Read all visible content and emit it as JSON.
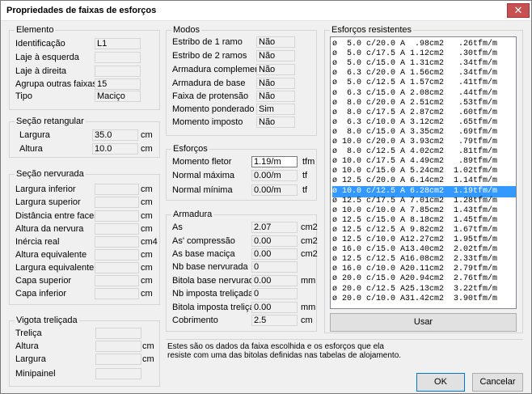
{
  "window": {
    "title": "Propriedades de faixas de esforços",
    "close": "✕"
  },
  "elemento": {
    "legend": "Elemento",
    "rows": [
      {
        "label": "Identificação",
        "value": "L1"
      },
      {
        "label": "Laje à esquerda",
        "value": ""
      },
      {
        "label": "Laje à direita",
        "value": ""
      },
      {
        "label": "Agrupa outras faixas",
        "value": "15"
      },
      {
        "label": "Tipo",
        "value": "Maciço"
      }
    ]
  },
  "secao_ret": {
    "legend": "Seção retangular",
    "rows": [
      {
        "label": "Largura",
        "value": "35.0",
        "unit": "cm"
      },
      {
        "label": "Altura",
        "value": "10.0",
        "unit": "cm"
      }
    ]
  },
  "secao_nerv": {
    "legend": "Seção nervurada",
    "rows": [
      {
        "label": "Largura inferior",
        "value": "",
        "unit": "cm"
      },
      {
        "label": "Largura superior",
        "value": "",
        "unit": "cm"
      },
      {
        "label": "Distância entre faces",
        "value": "",
        "unit": "cm"
      },
      {
        "label": "Altura da nervura",
        "value": "",
        "unit": "cm"
      },
      {
        "label": "Inércia real",
        "value": "",
        "unit": "cm4"
      },
      {
        "label": "Altura equivalente",
        "value": "",
        "unit": "cm"
      },
      {
        "label": "Largura equivalente",
        "value": "",
        "unit": "cm"
      },
      {
        "label": "Capa superior",
        "value": "",
        "unit": "cm"
      },
      {
        "label": "Capa inferior",
        "value": "",
        "unit": "cm"
      }
    ]
  },
  "vigota": {
    "legend": "Vigota treliçada",
    "rows": [
      {
        "label": "Treliça",
        "value": "",
        "unit": ""
      },
      {
        "label": "Altura",
        "value": "",
        "unit": "cm"
      },
      {
        "label": "Largura",
        "value": "",
        "unit": "cm"
      },
      {
        "label": "Minipainel",
        "value": "",
        "unit": ""
      }
    ]
  },
  "modos": {
    "legend": "Modos",
    "rows": [
      {
        "label": "Estribo de 1 ramo",
        "value": "Não"
      },
      {
        "label": "Estribo de 2 ramos",
        "value": "Não"
      },
      {
        "label": "Armadura complementar",
        "value": "Não"
      },
      {
        "label": "Armadura de base",
        "value": "Não"
      },
      {
        "label": "Faixa de protensão",
        "value": "Não"
      },
      {
        "label": "Momento ponderado",
        "value": "Sim"
      },
      {
        "label": "Momento imposto",
        "value": "Não"
      }
    ]
  },
  "esforcos": {
    "legend": "Esforços",
    "rows": [
      {
        "label": "Momento fletor",
        "value": "1.19/m",
        "unit": "tfm"
      },
      {
        "label": "Normal máxima",
        "value": "0.00/m",
        "unit": "tf"
      },
      {
        "label": "Normal mínima",
        "value": "0.00/m",
        "unit": "tf"
      }
    ]
  },
  "armadura": {
    "legend": "Armadura",
    "rows": [
      {
        "label": "As",
        "value": "2.07",
        "unit": "cm2"
      },
      {
        "label": "As' compressão",
        "value": "0.00",
        "unit": "cm2"
      },
      {
        "label": "As base maciça",
        "value": "0.00",
        "unit": "cm2"
      },
      {
        "label": "Nb base nervurada",
        "value": "0",
        "unit": ""
      },
      {
        "label": "Bitola base nervurada",
        "value": "0.00",
        "unit": "mm"
      },
      {
        "label": "Nb imposta treliçada",
        "value": "0",
        "unit": ""
      },
      {
        "label": "Bitola imposta treliçada",
        "value": "0.00",
        "unit": "mm"
      },
      {
        "label": "Cobrimento",
        "value": "2.5",
        "unit": "cm"
      }
    ]
  },
  "resistentes": {
    "legend": "Esforços resistentes",
    "selected_index": 12,
    "items": [
      "ø  5.0 c/20.0 A  .98cm2   .26tfm/m",
      "ø  5.0 c/17.5 A 1.12cm2   .30tfm/m",
      "ø  5.0 c/15.0 A 1.31cm2   .34tfm/m",
      "ø  6.3 c/20.0 A 1.56cm2   .34tfm/m",
      "ø  5.0 c/12.5 A 1.57cm2   .41tfm/m",
      "ø  6.3 c/15.0 A 2.08cm2   .44tfm/m",
      "ø  8.0 c/20.0 A 2.51cm2   .53tfm/m",
      "ø  8.0 c/17.5 A 2.87cm2   .60tfm/m",
      "ø  6.3 c/10.0 A 3.12cm2   .65tfm/m",
      "ø  8.0 c/15.0 A 3.35cm2   .69tfm/m",
      "ø 10.0 c/20.0 A 3.93cm2   .79tfm/m",
      "ø  8.0 c/12.5 A 4.02cm2   .81tfm/m",
      "ø 10.0 c/17.5 A 4.49cm2   .89tfm/m",
      "ø 10.0 c/15.0 A 5.24cm2  1.02tfm/m",
      "ø 12.5 c/20.0 A 6.14cm2  1.14tfm/m",
      "ø 10.0 c/12.5 A 6.28cm2  1.19tfm/m",
      "ø 12.5 c/17.5 A 7.01cm2  1.28tfm/m",
      "ø 10.0 c/10.0 A 7.85cm2  1.43tfm/m",
      "ø 12.5 c/15.0 A 8.18cm2  1.45tfm/m",
      "ø 12.5 c/12.5 A 9.82cm2  1.67tfm/m",
      "ø 12.5 c/10.0 A12.27cm2  1.95tfm/m",
      "ø 16.0 c/15.0 A13.40cm2  2.02tfm/m",
      "ø 12.5 c/12.5 A16.08cm2  2.33tfm/m",
      "ø 16.0 c/10.0 A20.11cm2  2.79tfm/m",
      "ø 20.0 c/15.0 A20.94cm2  2.76tfm/m",
      "ø 20.0 c/12.5 A25.13cm2  3.22tfm/m",
      "ø 20.0 c/10.0 A31.42cm2  3.90tfm/m"
    ],
    "use_button": "Usar"
  },
  "info_text": "Estes são os dados da faixa escolhida e os esforços que ela resiste com uma das bitolas definidas nas tabelas de alojamento.",
  "buttons": {
    "ok": "OK",
    "cancel": "Cancelar"
  }
}
